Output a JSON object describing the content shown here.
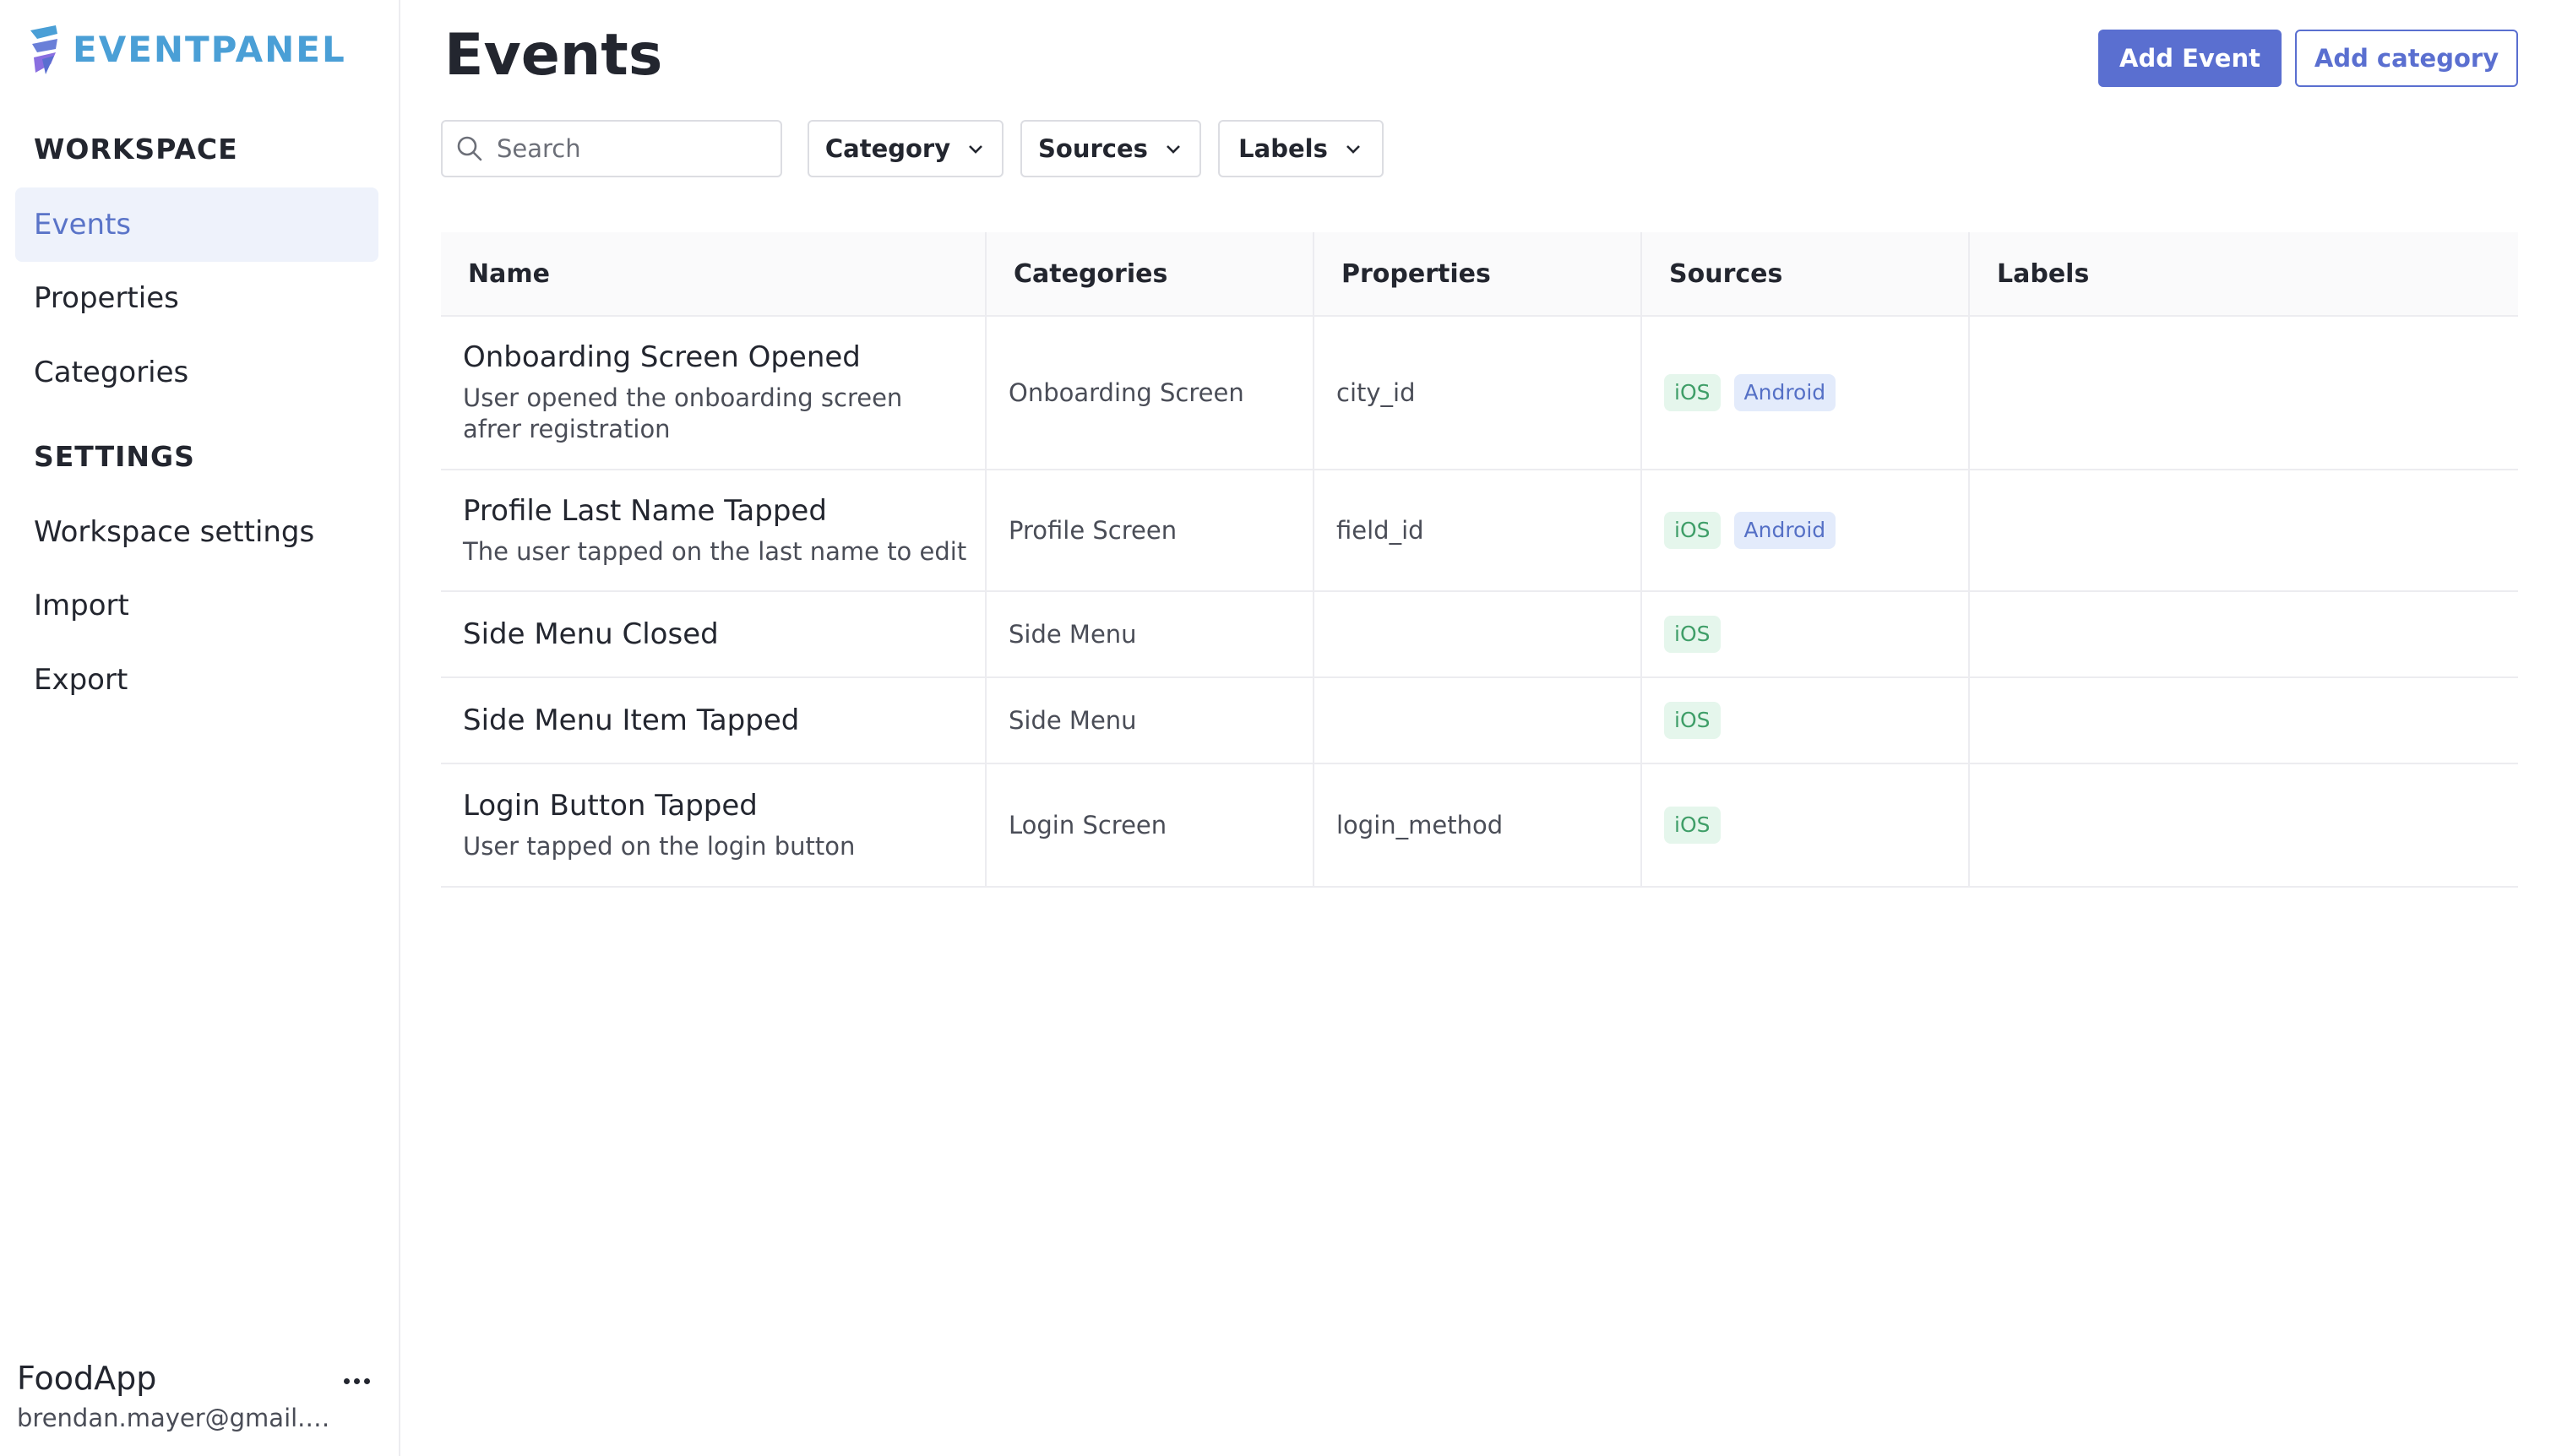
{
  "brand": {
    "name": "EVENTPANEL"
  },
  "sidebar": {
    "workspace_title": "WORKSPACE",
    "workspace_items": [
      {
        "label": "Events",
        "active": true
      },
      {
        "label": "Properties",
        "active": false
      },
      {
        "label": "Categories",
        "active": false
      }
    ],
    "settings_title": "SETTINGS",
    "settings_items": [
      {
        "label": "Workspace settings"
      },
      {
        "label": "Import"
      },
      {
        "label": "Export"
      }
    ],
    "account": {
      "name": "FoodApp",
      "email": "brendan.mayer@gmail.c..."
    }
  },
  "header": {
    "title": "Events",
    "add_event_label": "Add Event",
    "add_category_label": "Add category"
  },
  "filters": {
    "search_placeholder": "Search",
    "category_label": "Category",
    "sources_label": "Sources",
    "labels_label": "Labels"
  },
  "table": {
    "columns": [
      "Name",
      "Categories",
      "Properties",
      "Sources",
      "Labels"
    ],
    "rows": [
      {
        "name": "Onboarding Screen Opened",
        "description": "User opened the onboarding screen afrer registration",
        "category": "Onboarding Screen",
        "property": "city_id",
        "sources": [
          "iOS",
          "Android"
        ],
        "labels": ""
      },
      {
        "name": "Profile Last Name Tapped",
        "description": "The user tapped on the last name to edit",
        "category": "Profile Screen",
        "property": "field_id",
        "sources": [
          "iOS",
          "Android"
        ],
        "labels": ""
      },
      {
        "name": "Side Menu Closed",
        "description": "",
        "category": "Side Menu",
        "property": "",
        "sources": [
          "iOS"
        ],
        "labels": ""
      },
      {
        "name": "Side Menu Item Tapped",
        "description": "",
        "category": "Side Menu",
        "property": "",
        "sources": [
          "iOS"
        ],
        "labels": ""
      },
      {
        "name": "Login Button Tapped",
        "description": "User tapped on the login button",
        "category": "Login Screen",
        "property": "login_method",
        "sources": [
          "iOS"
        ],
        "labels": ""
      }
    ]
  },
  "colors": {
    "accent": "#5a6fd0",
    "brand": "#4a9fd6",
    "active_nav_bg": "#eef2fb",
    "ios_badge_bg": "#e5f6ec",
    "ios_badge_text": "#3f9e68",
    "android_badge_bg": "#e3ebfb",
    "android_badge_text": "#5570c6"
  },
  "icons": {
    "logo": "eventpanel-logo-icon",
    "search": "search-icon",
    "dropdown": "chevron-down-icon",
    "more": "more-horizontal-icon"
  }
}
